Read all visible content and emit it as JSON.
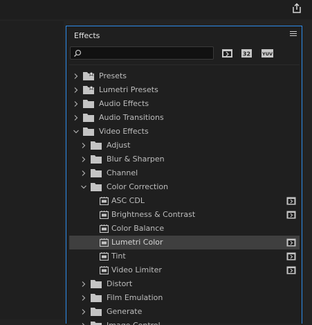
{
  "panel": {
    "title": "Effects"
  },
  "search": {
    "placeholder": "",
    "value": ""
  },
  "filters": [
    {
      "id": "accelerated",
      "label": ""
    },
    {
      "id": "32bit",
      "label": "32"
    },
    {
      "id": "yuv",
      "label": "YUV"
    }
  ],
  "tree": [
    {
      "label": "Presets",
      "kind": "folder",
      "depth": 0,
      "expanded": false,
      "starred": true
    },
    {
      "label": "Lumetri Presets",
      "kind": "folder",
      "depth": 0,
      "expanded": false,
      "starred": true
    },
    {
      "label": "Audio Effects",
      "kind": "folder",
      "depth": 0,
      "expanded": false
    },
    {
      "label": "Audio Transitions",
      "kind": "folder",
      "depth": 0,
      "expanded": false
    },
    {
      "label": "Video Effects",
      "kind": "folder",
      "depth": 0,
      "expanded": true
    },
    {
      "label": "Adjust",
      "kind": "folder",
      "depth": 1,
      "expanded": false
    },
    {
      "label": "Blur & Sharpen",
      "kind": "folder",
      "depth": 1,
      "expanded": false
    },
    {
      "label": "Channel",
      "kind": "folder",
      "depth": 1,
      "expanded": false
    },
    {
      "label": "Color Correction",
      "kind": "folder",
      "depth": 1,
      "expanded": true
    },
    {
      "label": "ASC CDL",
      "kind": "effect",
      "depth": 2,
      "accelerated": true
    },
    {
      "label": "Brightness & Contrast",
      "kind": "effect",
      "depth": 2,
      "accelerated": true
    },
    {
      "label": "Color Balance",
      "kind": "effect",
      "depth": 2,
      "accelerated": false
    },
    {
      "label": "Lumetri Color",
      "kind": "effect",
      "depth": 2,
      "accelerated": true,
      "selected": true
    },
    {
      "label": "Tint",
      "kind": "effect",
      "depth": 2,
      "accelerated": true
    },
    {
      "label": "Video Limiter",
      "kind": "effect",
      "depth": 2,
      "accelerated": true
    },
    {
      "label": "Distort",
      "kind": "folder",
      "depth": 1,
      "expanded": false
    },
    {
      "label": "Film Emulation",
      "kind": "folder",
      "depth": 1,
      "expanded": false
    },
    {
      "label": "Generate",
      "kind": "folder",
      "depth": 1,
      "expanded": false
    },
    {
      "label": "Image Control",
      "kind": "folder",
      "depth": 1,
      "expanded": false
    }
  ]
}
